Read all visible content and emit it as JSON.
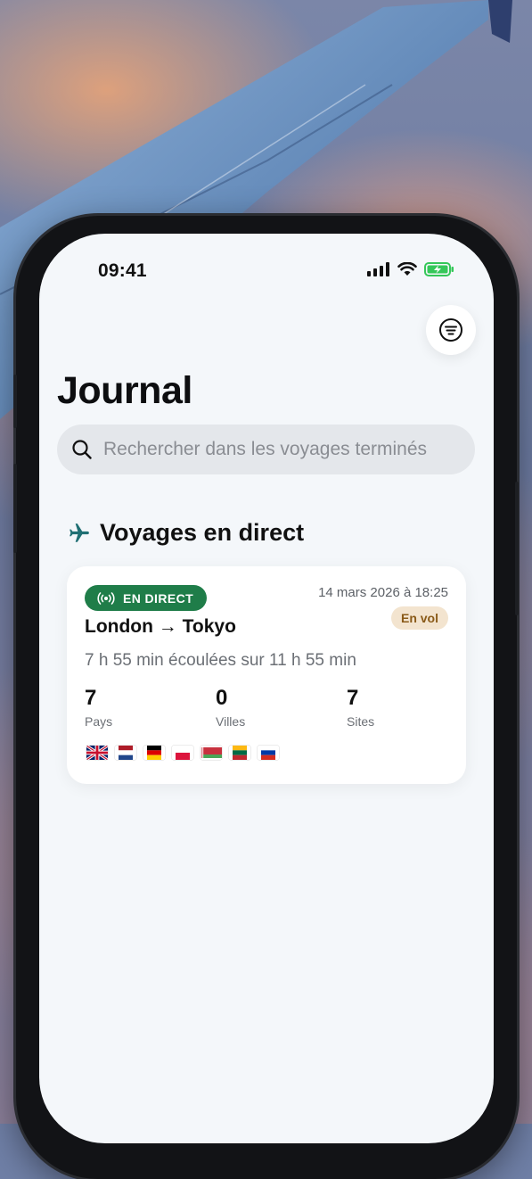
{
  "status_bar": {
    "time": "09:41"
  },
  "header": {
    "title": "Journal"
  },
  "search": {
    "placeholder": "Rechercher dans les voyages terminés"
  },
  "live_section": {
    "title": "Voyages en direct",
    "trip": {
      "badge": "EN DIRECT",
      "date": "14 mars 2026 à 18:25",
      "status": "En vol",
      "route": "London → Tokyo",
      "elapsed": "7 h 55 min écoulées sur 11 h 55 min",
      "stats": [
        {
          "value": "7",
          "label": "Pays"
        },
        {
          "value": "0",
          "label": "Villes"
        },
        {
          "value": "7",
          "label": "Sites"
        }
      ],
      "flags": [
        "flag-gb-icon",
        "flag-nl-icon",
        "flag-de-icon",
        "flag-pl-icon",
        "flag-by-icon",
        "flag-lt-icon",
        "flag-ru-icon"
      ]
    }
  },
  "colors": {
    "live_badge": "#1f7d49",
    "status_pill_bg": "#f3e4cf",
    "status_pill_text": "#8a5a18",
    "plane_icon": "#1f6f73",
    "screen_bg": "#f4f7fa"
  },
  "icons": [
    "plane-wing-photo",
    "signal-icon",
    "wifi-icon",
    "battery-icon",
    "filter-icon",
    "search-icon",
    "plane-icon",
    "broadcast-icon"
  ]
}
